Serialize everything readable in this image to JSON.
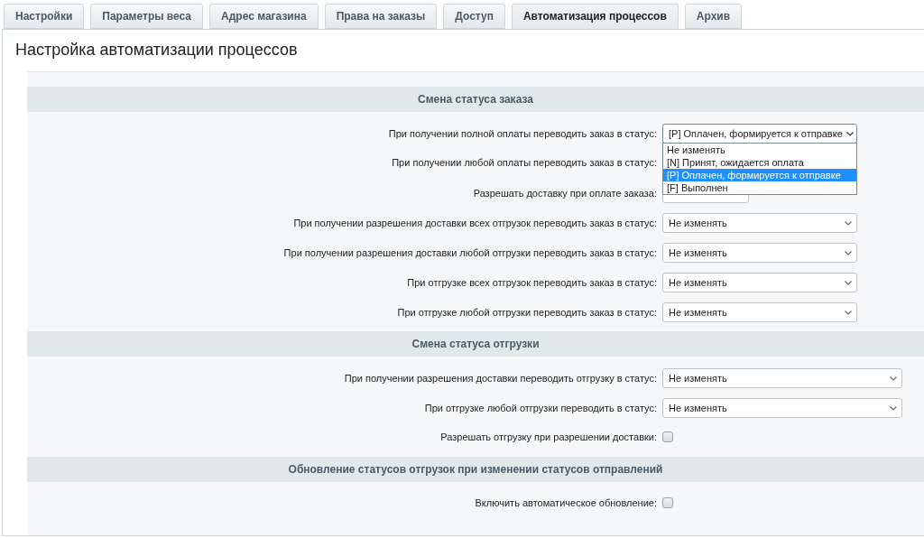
{
  "tabs": [
    {
      "label": "Настройки",
      "selected": false
    },
    {
      "label": "Параметры веса",
      "selected": false
    },
    {
      "label": "Адрес магазина",
      "selected": false
    },
    {
      "label": "Права на заказы",
      "selected": false
    },
    {
      "label": "Доступ",
      "selected": false
    },
    {
      "label": "Автоматизация процессов",
      "selected": true
    },
    {
      "label": "Архив",
      "selected": false
    }
  ],
  "title": "Настройка автоматизации процессов",
  "sections": [
    {
      "heading": "Смена статуса заказа",
      "groups": [
        [
          {
            "kind": "select",
            "label": "При получении полной оплаты переводить заказ в статус:",
            "value": "[P] Оплачен, формируется к отправке",
            "open": true,
            "options": [
              {
                "label": "Не изменять",
                "selected": false
              },
              {
                "label": "[N] Принят, ожидается оплата",
                "selected": false
              },
              {
                "label": "[P] Оплачен, формируется к отправке",
                "selected": true
              },
              {
                "label": "[F] Выполнен",
                "selected": false
              }
            ]
          },
          {
            "kind": "hidden",
            "label": "При получении любой оплаты переводить заказ в статус:"
          },
          {
            "kind": "short_select",
            "label": "Разрешать доставку при оплате заказа:"
          }
        ],
        [
          {
            "kind": "select",
            "label": "При получении разрешения доставки всех отгрузок переводить заказ в статус:",
            "value": "Не изменять",
            "open": false
          },
          {
            "kind": "select",
            "label": "При получении разрешения доставки любой отгрузки переводить заказ в статус:",
            "value": "Не изменять",
            "open": false
          },
          {
            "kind": "select",
            "label": "При отгрузке всех отгрузок переводить заказ в статус:",
            "value": "Не изменять",
            "open": false
          },
          {
            "kind": "select",
            "label": "При отгрузке любой отгрузки переводить заказ в статус:",
            "value": "Не изменять",
            "open": false
          }
        ]
      ]
    },
    {
      "heading": "Смена статуса отгрузки",
      "wide": true,
      "groups": [
        [
          {
            "kind": "select",
            "label": "При получении разрешения доставки переводить отгрузку в статус:",
            "value": "Не изменять",
            "open": false
          },
          {
            "kind": "select",
            "label": "При отгрузке любой отгрузки переводить в статус:",
            "value": "Не изменять",
            "open": false
          },
          {
            "kind": "checkbox",
            "label": "Разрешать отгрузку при разрешении доставки:",
            "checked": false
          }
        ]
      ]
    },
    {
      "heading": "Обновление статусов отгрузок при изменении статусов отправлений",
      "groups": [
        [
          {
            "kind": "checkbox",
            "label": "Включить автоматическое обновление:",
            "checked": false
          }
        ]
      ]
    }
  ]
}
